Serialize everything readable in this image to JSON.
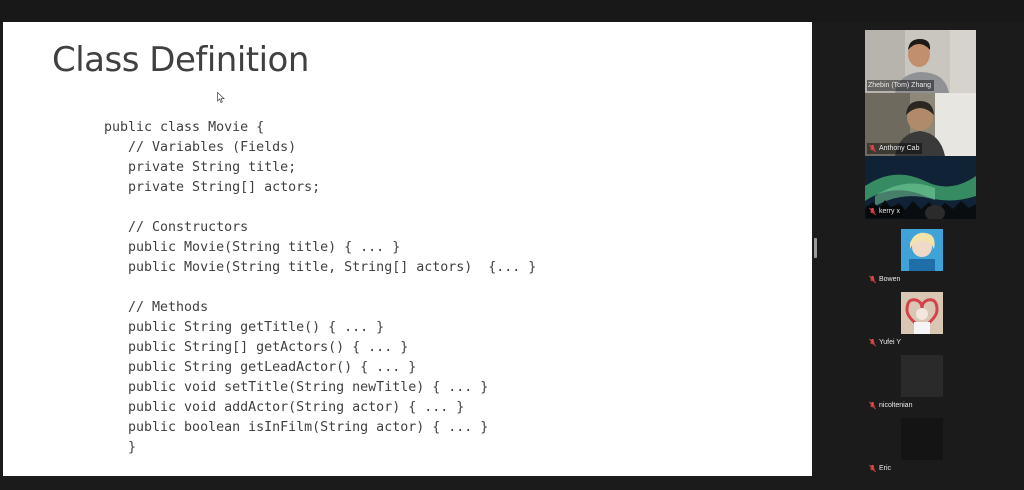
{
  "slide": {
    "title": "Class Definition",
    "code_lines": [
      "public class Movie {",
      "   // Variables (Fields)",
      "   private String title;",
      "   private String[] actors;",
      "",
      "   // Constructors",
      "   public Movie(String title) { ... }",
      "   public Movie(String title, String[] actors)  {... }",
      "",
      "   // Methods",
      "   public String getTitle() { ... }",
      "   public String[] getActors() { ... }",
      "   public String getLeadActor() { ... }",
      "   public void setTitle(String newTitle) { ... }",
      "   public void addActor(String actor) { ... }",
      "   public boolean isInFilm(String actor) { ... }",
      "   }"
    ]
  },
  "participants": [
    {
      "name": "Zhebin (Tom) Zhang",
      "muted": false,
      "active_speaker": true
    },
    {
      "name": "Anthony Cab",
      "muted": true
    },
    {
      "name": "kerry x",
      "muted": true
    },
    {
      "name": "Bowen",
      "muted": true
    },
    {
      "name": "Yufei Y",
      "muted": true
    },
    {
      "name": "nicoltenian",
      "muted": true
    },
    {
      "name": "Eric",
      "muted": true
    }
  ],
  "colors": {
    "active_speaker_border": "#3cc37a",
    "muted_icon": "#e0484a",
    "background": "#1b1b1b"
  }
}
